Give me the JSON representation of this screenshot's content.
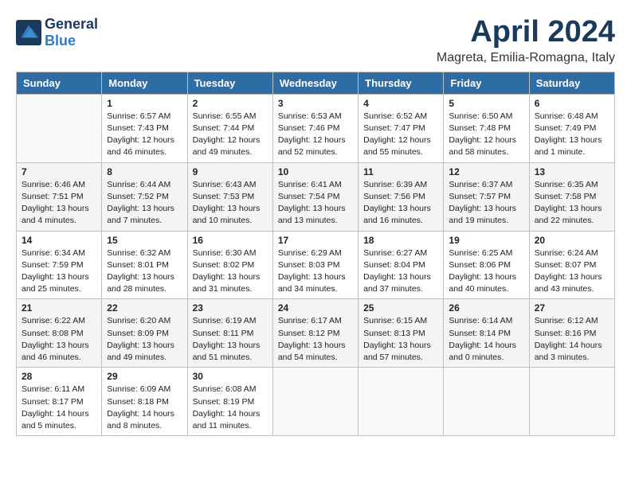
{
  "logo": {
    "general": "General",
    "blue": "Blue"
  },
  "title": "April 2024",
  "location": "Magreta, Emilia-Romagna, Italy",
  "days_of_week": [
    "Sunday",
    "Monday",
    "Tuesday",
    "Wednesday",
    "Thursday",
    "Friday",
    "Saturday"
  ],
  "weeks": [
    [
      {
        "day": "",
        "sunrise": "",
        "sunset": "",
        "daylight": ""
      },
      {
        "day": "1",
        "sunrise": "Sunrise: 6:57 AM",
        "sunset": "Sunset: 7:43 PM",
        "daylight": "Daylight: 12 hours and 46 minutes."
      },
      {
        "day": "2",
        "sunrise": "Sunrise: 6:55 AM",
        "sunset": "Sunset: 7:44 PM",
        "daylight": "Daylight: 12 hours and 49 minutes."
      },
      {
        "day": "3",
        "sunrise": "Sunrise: 6:53 AM",
        "sunset": "Sunset: 7:46 PM",
        "daylight": "Daylight: 12 hours and 52 minutes."
      },
      {
        "day": "4",
        "sunrise": "Sunrise: 6:52 AM",
        "sunset": "Sunset: 7:47 PM",
        "daylight": "Daylight: 12 hours and 55 minutes."
      },
      {
        "day": "5",
        "sunrise": "Sunrise: 6:50 AM",
        "sunset": "Sunset: 7:48 PM",
        "daylight": "Daylight: 12 hours and 58 minutes."
      },
      {
        "day": "6",
        "sunrise": "Sunrise: 6:48 AM",
        "sunset": "Sunset: 7:49 PM",
        "daylight": "Daylight: 13 hours and 1 minute."
      }
    ],
    [
      {
        "day": "7",
        "sunrise": "Sunrise: 6:46 AM",
        "sunset": "Sunset: 7:51 PM",
        "daylight": "Daylight: 13 hours and 4 minutes."
      },
      {
        "day": "8",
        "sunrise": "Sunrise: 6:44 AM",
        "sunset": "Sunset: 7:52 PM",
        "daylight": "Daylight: 13 hours and 7 minutes."
      },
      {
        "day": "9",
        "sunrise": "Sunrise: 6:43 AM",
        "sunset": "Sunset: 7:53 PM",
        "daylight": "Daylight: 13 hours and 10 minutes."
      },
      {
        "day": "10",
        "sunrise": "Sunrise: 6:41 AM",
        "sunset": "Sunset: 7:54 PM",
        "daylight": "Daylight: 13 hours and 13 minutes."
      },
      {
        "day": "11",
        "sunrise": "Sunrise: 6:39 AM",
        "sunset": "Sunset: 7:56 PM",
        "daylight": "Daylight: 13 hours and 16 minutes."
      },
      {
        "day": "12",
        "sunrise": "Sunrise: 6:37 AM",
        "sunset": "Sunset: 7:57 PM",
        "daylight": "Daylight: 13 hours and 19 minutes."
      },
      {
        "day": "13",
        "sunrise": "Sunrise: 6:35 AM",
        "sunset": "Sunset: 7:58 PM",
        "daylight": "Daylight: 13 hours and 22 minutes."
      }
    ],
    [
      {
        "day": "14",
        "sunrise": "Sunrise: 6:34 AM",
        "sunset": "Sunset: 7:59 PM",
        "daylight": "Daylight: 13 hours and 25 minutes."
      },
      {
        "day": "15",
        "sunrise": "Sunrise: 6:32 AM",
        "sunset": "Sunset: 8:01 PM",
        "daylight": "Daylight: 13 hours and 28 minutes."
      },
      {
        "day": "16",
        "sunrise": "Sunrise: 6:30 AM",
        "sunset": "Sunset: 8:02 PM",
        "daylight": "Daylight: 13 hours and 31 minutes."
      },
      {
        "day": "17",
        "sunrise": "Sunrise: 6:29 AM",
        "sunset": "Sunset: 8:03 PM",
        "daylight": "Daylight: 13 hours and 34 minutes."
      },
      {
        "day": "18",
        "sunrise": "Sunrise: 6:27 AM",
        "sunset": "Sunset: 8:04 PM",
        "daylight": "Daylight: 13 hours and 37 minutes."
      },
      {
        "day": "19",
        "sunrise": "Sunrise: 6:25 AM",
        "sunset": "Sunset: 8:06 PM",
        "daylight": "Daylight: 13 hours and 40 minutes."
      },
      {
        "day": "20",
        "sunrise": "Sunrise: 6:24 AM",
        "sunset": "Sunset: 8:07 PM",
        "daylight": "Daylight: 13 hours and 43 minutes."
      }
    ],
    [
      {
        "day": "21",
        "sunrise": "Sunrise: 6:22 AM",
        "sunset": "Sunset: 8:08 PM",
        "daylight": "Daylight: 13 hours and 46 minutes."
      },
      {
        "day": "22",
        "sunrise": "Sunrise: 6:20 AM",
        "sunset": "Sunset: 8:09 PM",
        "daylight": "Daylight: 13 hours and 49 minutes."
      },
      {
        "day": "23",
        "sunrise": "Sunrise: 6:19 AM",
        "sunset": "Sunset: 8:11 PM",
        "daylight": "Daylight: 13 hours and 51 minutes."
      },
      {
        "day": "24",
        "sunrise": "Sunrise: 6:17 AM",
        "sunset": "Sunset: 8:12 PM",
        "daylight": "Daylight: 13 hours and 54 minutes."
      },
      {
        "day": "25",
        "sunrise": "Sunrise: 6:15 AM",
        "sunset": "Sunset: 8:13 PM",
        "daylight": "Daylight: 13 hours and 57 minutes."
      },
      {
        "day": "26",
        "sunrise": "Sunrise: 6:14 AM",
        "sunset": "Sunset: 8:14 PM",
        "daylight": "Daylight: 14 hours and 0 minutes."
      },
      {
        "day": "27",
        "sunrise": "Sunrise: 6:12 AM",
        "sunset": "Sunset: 8:16 PM",
        "daylight": "Daylight: 14 hours and 3 minutes."
      }
    ],
    [
      {
        "day": "28",
        "sunrise": "Sunrise: 6:11 AM",
        "sunset": "Sunset: 8:17 PM",
        "daylight": "Daylight: 14 hours and 5 minutes."
      },
      {
        "day": "29",
        "sunrise": "Sunrise: 6:09 AM",
        "sunset": "Sunset: 8:18 PM",
        "daylight": "Daylight: 14 hours and 8 minutes."
      },
      {
        "day": "30",
        "sunrise": "Sunrise: 6:08 AM",
        "sunset": "Sunset: 8:19 PM",
        "daylight": "Daylight: 14 hours and 11 minutes."
      },
      {
        "day": "",
        "sunrise": "",
        "sunset": "",
        "daylight": ""
      },
      {
        "day": "",
        "sunrise": "",
        "sunset": "",
        "daylight": ""
      },
      {
        "day": "",
        "sunrise": "",
        "sunset": "",
        "daylight": ""
      },
      {
        "day": "",
        "sunrise": "",
        "sunset": "",
        "daylight": ""
      }
    ]
  ]
}
